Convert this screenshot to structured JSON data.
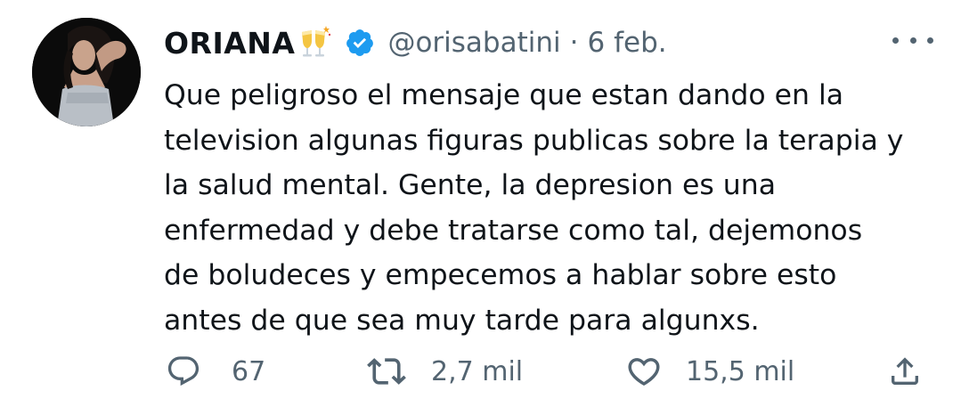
{
  "tweet": {
    "author": {
      "display_name": "ORIANA",
      "emoji": "clinking-glasses-emoji",
      "verified": true,
      "handle": "@orisabatini",
      "separator": "·",
      "date": "6 feb."
    },
    "text_lines": [
      "Que peligroso el mensaje que estan dando en la",
      "television algunas figuras publicas sobre la terapia y",
      "la salud mental. Gente, la depresion es una",
      "enfermedad y debe tratarse como tal, dejemonos",
      "de boludeces y empecemos a hablar sobre esto",
      "antes de que sea muy tarde para algunxs."
    ],
    "actions": {
      "reply_count": "67",
      "retweet_count": "2,7 mil",
      "like_count": "15,5 mil"
    },
    "icons": {
      "reply": "reply-bubble-icon",
      "retweet": "retweet-icon",
      "like": "heart-icon",
      "share": "share-icon",
      "more": "more-options-icon",
      "verified": "verified-badge-icon"
    },
    "colors": {
      "text": "#0f1419",
      "secondary": "#536471",
      "verified": "#1d9bf0"
    }
  }
}
